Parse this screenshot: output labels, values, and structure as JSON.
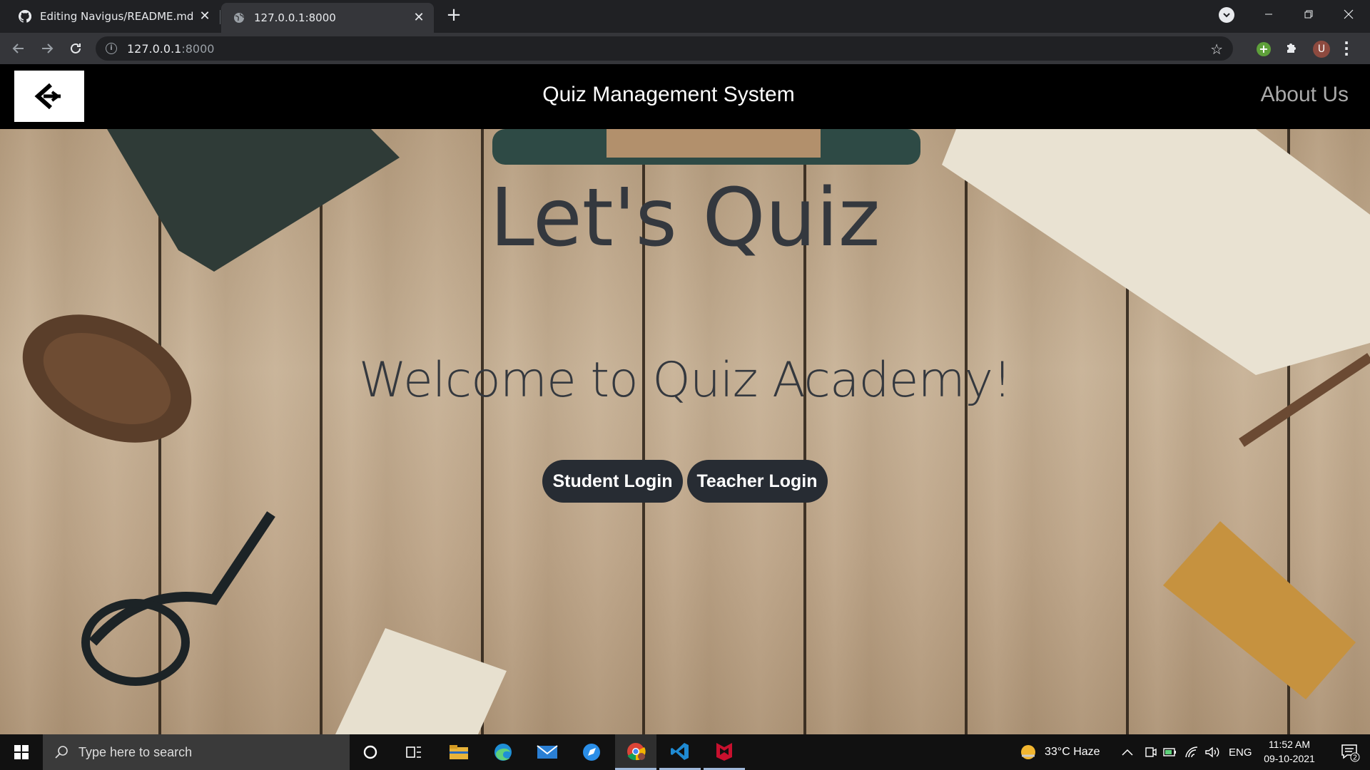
{
  "browser": {
    "tabs": [
      {
        "title": "Editing Navigus/README.md at",
        "favicon": "github-icon"
      },
      {
        "title": "127.0.0.1:8000",
        "favicon": "globe-icon"
      }
    ],
    "address": {
      "host": "127.0.0.1",
      "port": ":8000"
    },
    "profile_initial": "U"
  },
  "site": {
    "title": "Quiz Management System",
    "about_label": "About Us",
    "logo_icon": "back-arrow-logo-icon"
  },
  "hero": {
    "heading": "Let's Quiz",
    "welcome": "Welcome to Quiz Academy!",
    "buttons": [
      {
        "label": "Student Login"
      },
      {
        "label": "Teacher Login"
      }
    ]
  },
  "taskbar": {
    "search_placeholder": "Type here to search",
    "weather": "33°C  Haze",
    "language": "ENG",
    "time": "11:52 AM",
    "date": "09-10-2021",
    "notification_count": "2"
  },
  "colors": {
    "nav_bg": "#000000",
    "button_bg": "#272c33",
    "heading_text": "#34383e",
    "about_text": "#a9a9a9"
  }
}
